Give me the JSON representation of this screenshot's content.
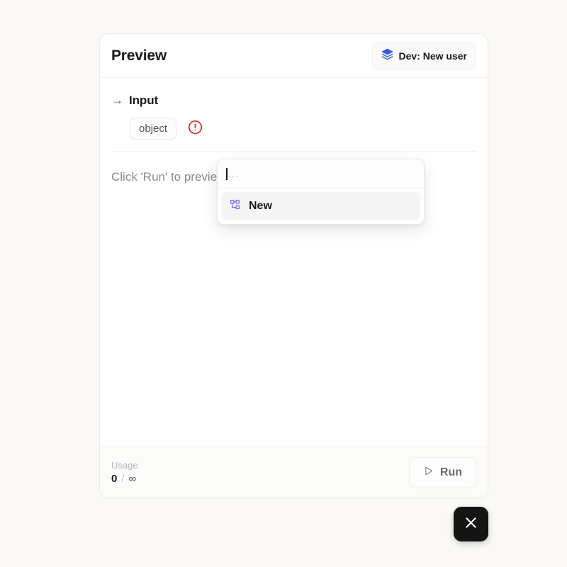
{
  "card": {
    "header": {
      "title": "Preview",
      "env_badge": {
        "label": "Dev: New user",
        "icon": "layers-icon",
        "icon_color": "#3b5bdb"
      }
    },
    "body": {
      "section": {
        "icon": "arrow-right-icon",
        "icon_color": "#3b5bdb",
        "title": "Input"
      },
      "input_row": {
        "type_badge": "object",
        "error_icon": "alert-circle-icon",
        "error_color": "#c0392b"
      },
      "empty_message": "Click 'Run' to preview and see logs, output or errors."
    },
    "combobox": {
      "value": "",
      "placeholder": "...",
      "options": [
        {
          "label": "New",
          "icon": "workflow-icon",
          "icon_color": "#7c6df2",
          "selected": true
        }
      ]
    },
    "footer": {
      "usage_label": "Usage",
      "usage_count": "0",
      "usage_separator": "/",
      "usage_limit": "∞",
      "run_button": {
        "label": "Run",
        "icon": "play-icon"
      }
    }
  },
  "close_button": {
    "icon": "close-icon",
    "background": "#141414"
  }
}
